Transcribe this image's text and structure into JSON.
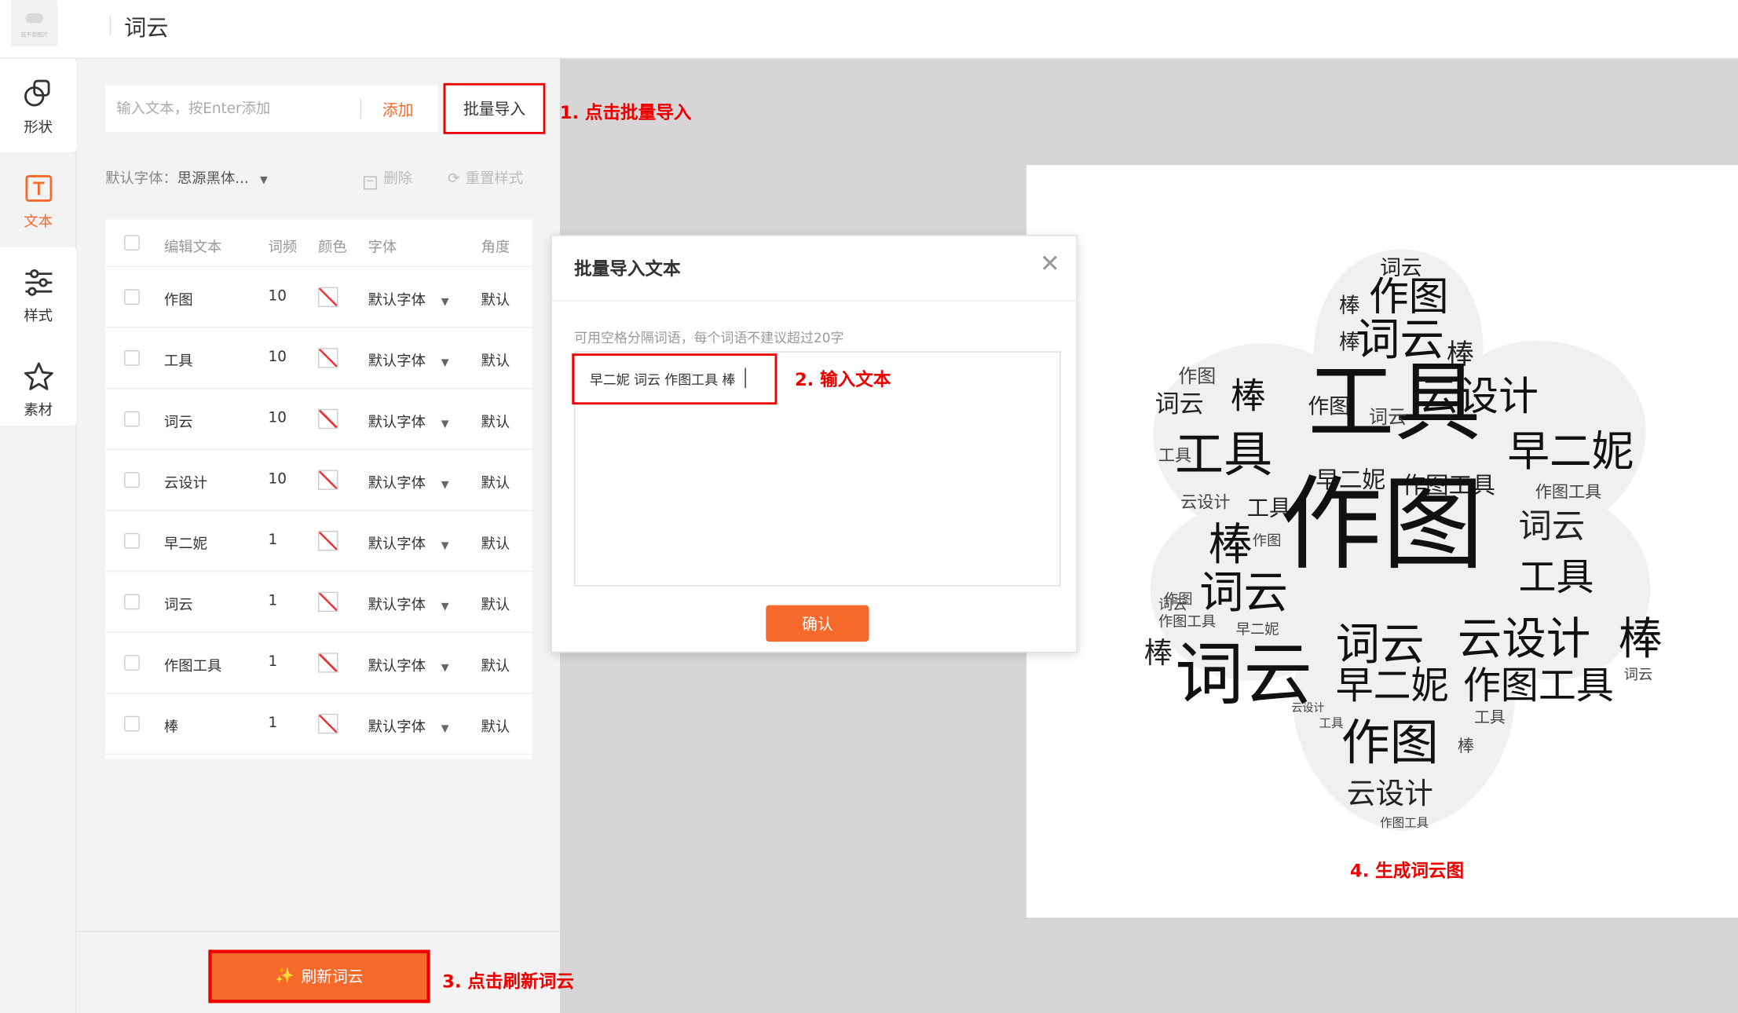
{
  "header": {
    "title": "词云",
    "logo_text": "我不帮图片"
  },
  "nav": [
    {
      "label": "形状",
      "icon": "shapes-icon"
    },
    {
      "label": "文本",
      "icon": "text-icon"
    },
    {
      "label": "样式",
      "icon": "sliders-icon"
    },
    {
      "label": "素材",
      "icon": "star-icon"
    }
  ],
  "panel": {
    "input_placeholder": "输入文本，按Enter添加",
    "add_label": "添加",
    "batch_label": "批量导入",
    "font_label": "默认字体：",
    "font_value": "思源黑体...",
    "delete_label": "删除",
    "reset_label": "重置样式",
    "table": {
      "headers": [
        "编辑文本",
        "词频",
        "颜色",
        "字体",
        "角度"
      ],
      "rows": [
        {
          "text": "作图",
          "freq": "10",
          "font": "默认字体",
          "angle": "默认"
        },
        {
          "text": "工具",
          "freq": "10",
          "font": "默认字体",
          "angle": "默认"
        },
        {
          "text": "词云",
          "freq": "10",
          "font": "默认字体",
          "angle": "默认"
        },
        {
          "text": "云设计",
          "freq": "10",
          "font": "默认字体",
          "angle": "默认"
        },
        {
          "text": "早二妮",
          "freq": "1",
          "font": "默认字体",
          "angle": "默认"
        },
        {
          "text": "词云",
          "freq": "1",
          "font": "默认字体",
          "angle": "默认"
        },
        {
          "text": "作图工具",
          "freq": "1",
          "font": "默认字体",
          "angle": "默认"
        },
        {
          "text": "棒",
          "freq": "1",
          "font": "默认字体",
          "angle": "默认"
        }
      ]
    },
    "refresh_label": "刷新词云"
  },
  "modal": {
    "title": "批量导入文本",
    "hint": "可用空格分隔词语，每个词语不建议超过20字",
    "text": "早二妮 词云 作图工具 棒",
    "confirm": "确认"
  },
  "annotations": {
    "a1": "1. 点击批量导入",
    "a2": "2. 输入文本",
    "a3": "3. 点击刷新词云",
    "a4": "4. 生成词云图"
  },
  "colors": {
    "accent": "#f7692b",
    "highlight": "#ee0000"
  },
  "wordcloud": [
    {
      "t": "词云",
      "s": 19
    },
    {
      "t": "作图",
      "s": 36
    },
    {
      "t": "棒",
      "s": 19
    },
    {
      "t": "棒",
      "s": 19
    },
    {
      "t": "词云",
      "s": 40
    },
    {
      "t": "棒",
      "s": 25
    },
    {
      "t": "作图",
      "s": 17
    },
    {
      "t": "词云",
      "s": 22
    },
    {
      "t": "棒",
      "s": 32
    },
    {
      "t": "工具",
      "s": 78
    },
    {
      "t": "云设计",
      "s": 36
    },
    {
      "t": "作图",
      "s": 19
    },
    {
      "t": "词云",
      "s": 17
    },
    {
      "t": "工具",
      "s": 44
    },
    {
      "t": "早二妮",
      "s": 38
    },
    {
      "t": "工具",
      "s": 15
    },
    {
      "t": "早二妮",
      "s": 21
    },
    {
      "t": "作图工具",
      "s": 21
    },
    {
      "t": "作图工具",
      "s": 15
    },
    {
      "t": "云设计",
      "s": 15
    },
    {
      "t": "工具",
      "s": 20
    },
    {
      "t": "棒",
      "s": 40
    },
    {
      "t": "作图",
      "s": 92
    },
    {
      "t": "词云",
      "s": 30
    },
    {
      "t": "工具",
      "s": 34
    },
    {
      "t": "作图",
      "s": 13
    },
    {
      "t": "词云",
      "s": 40
    },
    {
      "t": "词云",
      "s": 13
    },
    {
      "t": "作图",
      "s": 13
    },
    {
      "t": "作图工具",
      "s": 13
    },
    {
      "t": "早二妮",
      "s": 13
    },
    {
      "t": "棒",
      "s": 26
    },
    {
      "t": "词云",
      "s": 62
    },
    {
      "t": "词云",
      "s": 40
    },
    {
      "t": "云设计",
      "s": 40
    },
    {
      "t": "棒",
      "s": 40
    },
    {
      "t": "早二妮",
      "s": 34
    },
    {
      "t": "作图工具",
      "s": 34
    },
    {
      "t": "词云",
      "s": 13
    },
    {
      "t": "作图",
      "s": 44
    },
    {
      "t": "工具",
      "s": 14
    },
    {
      "t": "棒",
      "s": 15
    },
    {
      "t": "云设计",
      "s": 26
    },
    {
      "t": "作图工具",
      "s": 11
    },
    {
      "t": "云设计",
      "s": 10
    },
    {
      "t": "工具",
      "s": 11
    }
  ]
}
